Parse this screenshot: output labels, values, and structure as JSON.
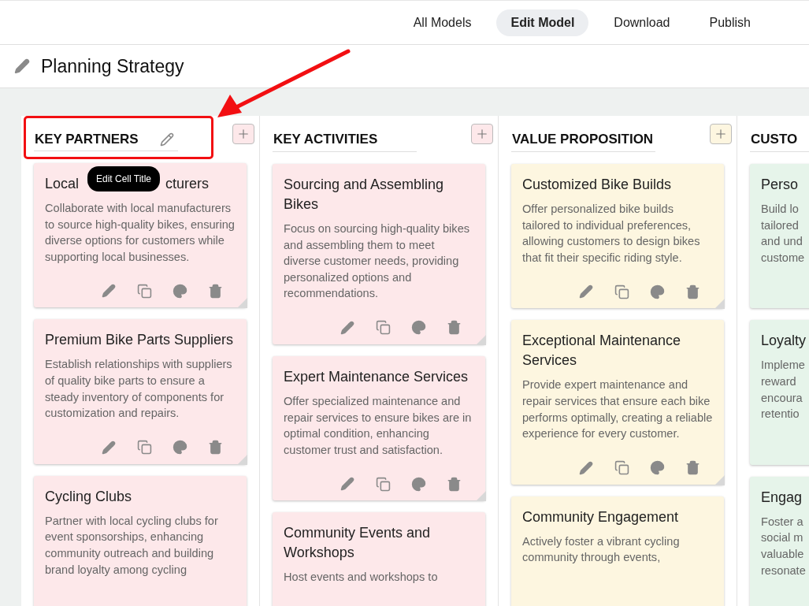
{
  "nav": [
    {
      "label": "All Models",
      "selected": false
    },
    {
      "label": "Edit Model",
      "selected": true
    },
    {
      "label": "Download",
      "selected": false
    },
    {
      "label": "Publish",
      "selected": false
    }
  ],
  "model_title": "Planning Strategy",
  "tooltip": "Edit Cell Title",
  "columns": [
    {
      "title": "KEY PARTNERS",
      "editing": true,
      "add_button": true,
      "color": "#fde8ea",
      "cards": [
        {
          "title_parts": [
            "Local",
            "cturers"
          ],
          "description": "Collaborate with local manufacturers to source high-quality bikes, ensuring diverse options for customers while supporting local businesses.",
          "actions": true
        },
        {
          "title_parts": [
            "Premium Bike Parts Suppliers"
          ],
          "description": "Establish relationships with suppliers of quality bike parts to ensure a steady inventory of components for customization and repairs.",
          "actions": true
        },
        {
          "title_parts": [
            "Cycling Clubs"
          ],
          "description": "Partner with local cycling clubs for event sponsorships, enhancing community outreach and building brand loyalty among cycling",
          "actions": false
        }
      ]
    },
    {
      "title": "KEY ACTIVITIES",
      "editing": false,
      "add_button": true,
      "color": "#fde8ea",
      "cards": [
        {
          "title_parts": [
            "Sourcing and Assembling Bikes"
          ],
          "description": "Focus on sourcing high-quality bikes and assembling them to meet diverse customer needs, providing personalized options and recommendations.",
          "actions": true
        },
        {
          "title_parts": [
            "Expert Maintenance Services"
          ],
          "description": "Offer specialized maintenance and repair services to ensure bikes are in optimal condition, enhancing customer trust and satisfaction.",
          "actions": true
        },
        {
          "title_parts": [
            "Community Events and Workshops"
          ],
          "description": "Host events and workshops to",
          "actions": false
        }
      ]
    },
    {
      "title": "VALUE PROPOSITION",
      "editing": false,
      "add_button": true,
      "color": "#fdf6e0",
      "cards": [
        {
          "title_parts": [
            "Customized Bike Builds"
          ],
          "description": "Offer personalized bike builds tailored to individual preferences, allowing customers to design bikes that fit their specific riding style.",
          "actions": true
        },
        {
          "title_parts": [
            "Exceptional Maintenance Services"
          ],
          "description": "Provide expert maintenance and repair services that ensure each bike performs optimally, creating a reliable experience for every customer.",
          "actions": true
        },
        {
          "title_parts": [
            "Community Engagement"
          ],
          "description": "Actively foster a vibrant cycling community through events,",
          "actions": false
        }
      ]
    },
    {
      "title": "CUSTO",
      "editing": false,
      "add_button": false,
      "color": "#e6f4ea",
      "cards": [
        {
          "title_parts": [
            "Perso"
          ],
          "description": "Build lo\ntailored\nand und\ncustome",
          "actions": false
        },
        {
          "title_parts": [
            "Loyalty"
          ],
          "description": "Impleme\nreward\nencoura\nretentio",
          "actions": false
        },
        {
          "title_parts": [
            "Engag"
          ],
          "description": "Foster a\nsocial m\nvaluable\nresonate",
          "actions": false
        }
      ]
    }
  ]
}
